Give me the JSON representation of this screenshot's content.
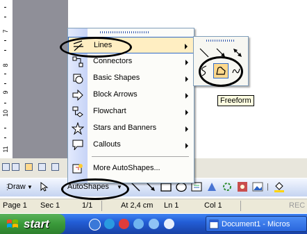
{
  "ruler": {
    "labels": [
      "7",
      "8",
      "9",
      "10",
      "11"
    ]
  },
  "autoshapes_menu": {
    "items": [
      {
        "label": "Lines",
        "icon": "lines-icon",
        "submenu": true
      },
      {
        "label": "Connectors",
        "icon": "connectors-icon",
        "submenu": true
      },
      {
        "label": "Basic Shapes",
        "icon": "basic-shapes-icon",
        "submenu": true
      },
      {
        "label": "Block Arrows",
        "icon": "block-arrows-icon",
        "submenu": true
      },
      {
        "label": "Flowchart",
        "icon": "flowchart-icon",
        "submenu": true
      },
      {
        "label": "Stars and Banners",
        "icon": "stars-banners-icon",
        "submenu": true
      },
      {
        "label": "Callouts",
        "icon": "callouts-icon",
        "submenu": true
      }
    ],
    "more": {
      "label": "More AutoShapes...",
      "icon": "clip-art-icon"
    }
  },
  "lines_submenu": {
    "tools": [
      "line-icon",
      "arrow-icon",
      "double-arrow-icon",
      "curve-icon",
      "freeform-icon",
      "scribble-icon"
    ]
  },
  "tooltip": {
    "text": "Freeform"
  },
  "drawing_toolbar": {
    "draw_label": "Draw",
    "autoshapes_label": "AutoShapes"
  },
  "status_bar": {
    "page": "Page 1",
    "sec": "Sec 1",
    "pages": "1/1",
    "at": "At 2,4 cm",
    "ln": "Ln 1",
    "col": "Col 1",
    "rec": "REC"
  },
  "taskbar": {
    "start_label": "start",
    "task_label": "Document1 - Micros"
  },
  "colors": {
    "highlight": "#ffeec2",
    "highlight_border": "#316ac5",
    "taskbar_blue": "#235ed6",
    "start_green": "#3a9a3a"
  }
}
